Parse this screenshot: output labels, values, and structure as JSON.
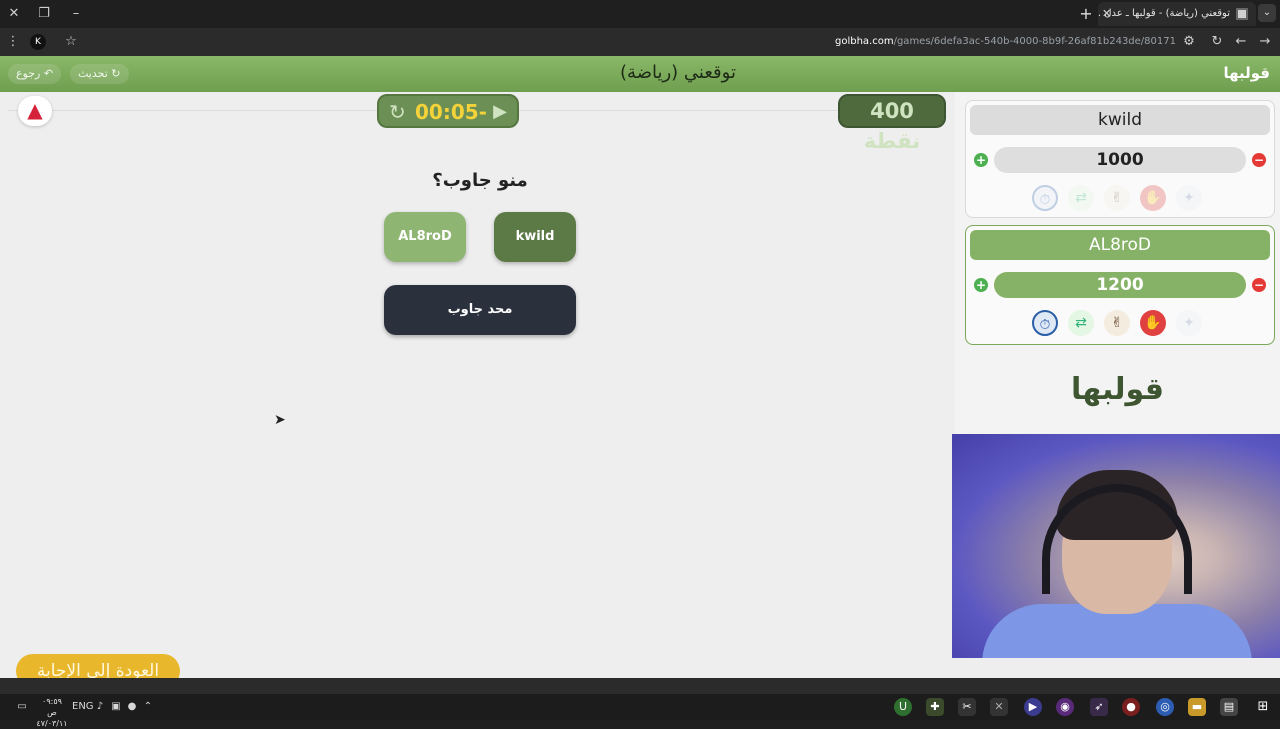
{
  "browser": {
    "tab_title": "توقعني (رياضة) - قولبها ـ عدل ...",
    "url_host": "golbha.com",
    "url_path": "/games/6defa3ac-540b-4000-8b9f-26af81b243de/80171",
    "profile_initial": "K"
  },
  "header": {
    "title": "توقعني (رياضة)",
    "back_label": "رجوع",
    "refresh_label": "تحديث",
    "logo_text": "قولبها"
  },
  "game": {
    "timer": "00:05-",
    "points": "400 نقطة",
    "question": "منو جاوب؟",
    "answer_player_1": "kwild",
    "answer_player_2": "AL8roD",
    "nobody_answered": "محد جاوب",
    "back_to_answer": "العودة إلى الإجابة"
  },
  "players": [
    {
      "name": "kwild",
      "score": "1000",
      "active": false
    },
    {
      "name": "AL8roD",
      "score": "1200",
      "active": true
    }
  ],
  "sidebar": {
    "brand_logo": "قولبها"
  },
  "taskbar": {
    "lang": "ENG",
    "time": "٠٩:٥٩ ص",
    "date": "٤٧/٠٣/١١"
  },
  "colors": {
    "accent_green": "#6e9e4e",
    "timer_yellow": "#f4d23a",
    "back_yellow": "#e8b72b",
    "danger_red": "#d6213b"
  }
}
